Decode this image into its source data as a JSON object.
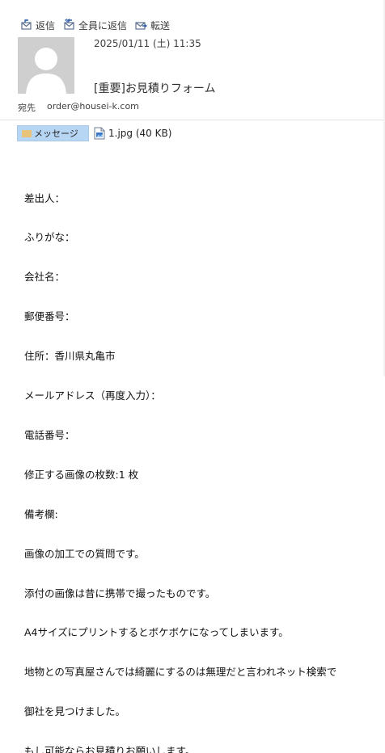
{
  "toolbar": {
    "reply_label": "返信",
    "reply_all_label": "全員に返信",
    "forward_label": "転送"
  },
  "header": {
    "date": "2025/01/11 (土) 11:35",
    "subject": "[重要]お見積りフォーム",
    "to_label": "宛先",
    "to_value": "order@housei-k.com"
  },
  "tabs": {
    "message_label": "メッセージ",
    "attachment_label": "1.jpg (40 KB)"
  },
  "body": {
    "lines": [
      "差出人：",
      "ふりがな：",
      "会社名：",
      "郵便番号：",
      "住所：香川県丸亀市",
      "メールアドレス（再度入力）：",
      "電話番号：",
      "修正する画像の枚数:1 枚",
      "備考欄:",
      "画像の加工での質問です。",
      "添付の画像は昔に携帯で撮ったものです。",
      "A4サイズにプリントするとボケボケになってしまいます。",
      "地物との写真屋さんでは綺麗にするのは無理だと言われネット検索で",
      "御社を見つけました。",
      "もし可能ならお見積りお願いします。"
    ]
  },
  "colors": {
    "tab_active": "#b7d6f3",
    "avatar_bg": "#cfcfcf",
    "icon_blue": "#4a6fa5"
  }
}
